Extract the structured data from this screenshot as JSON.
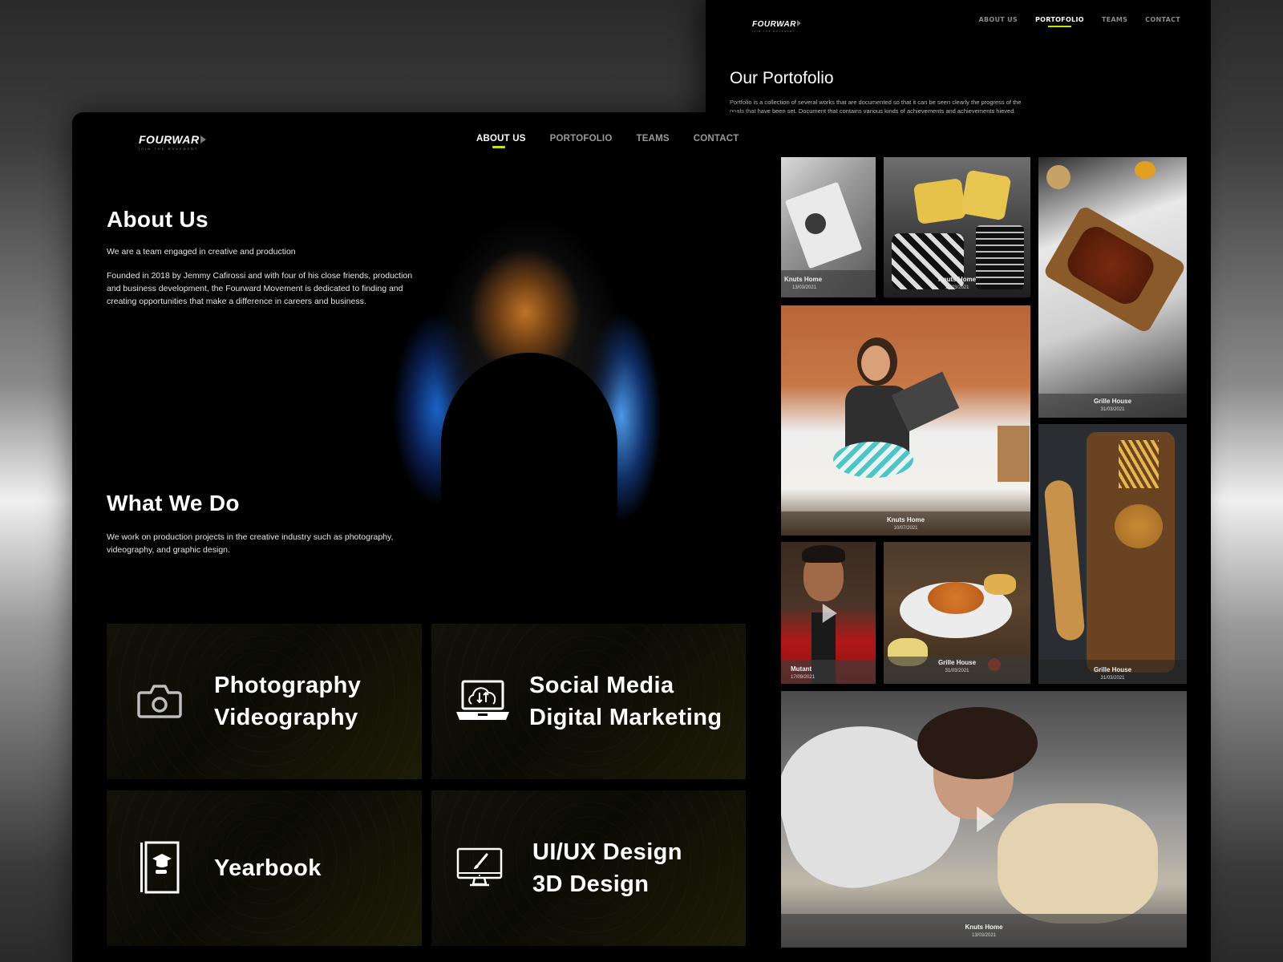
{
  "brand": {
    "name": "FOURWAR",
    "tagline": "JOIN THE MOVEMENT",
    "accent_color": "#c8e000"
  },
  "nav": {
    "items": [
      {
        "label": "ABOUT US"
      },
      {
        "label": "PORTOFOLIO"
      },
      {
        "label": "TEAMS"
      },
      {
        "label": "CONTACT"
      }
    ]
  },
  "portfolio_page": {
    "active_nav": "PORTOFOLIO",
    "title": "Our Portofolio",
    "description": "Portfolio is a collection of several works that are documented so that it can be seen clearly the progress of the goals that have been set. Document that contains various kinds of achievements and achievements hieved.",
    "items": [
      {
        "title": "Knuts Home",
        "date": "13/03/2021",
        "type": "photo"
      },
      {
        "title": "Knuts Home",
        "date": "13/03/2021",
        "type": "photo"
      },
      {
        "title": "Grille House",
        "date": "31/03/2021",
        "type": "photo"
      },
      {
        "title": "Knuts Home",
        "date": "10/07/2021",
        "type": "photo"
      },
      {
        "title": "Grille House",
        "date": "31/03/2021",
        "type": "photo"
      },
      {
        "title": "Mutant",
        "date": "17/09/2021",
        "type": "video"
      },
      {
        "title": "Grille House",
        "date": "31/03/2021",
        "type": "photo"
      },
      {
        "title": "Knuts Home",
        "date": "13/03/2021",
        "type": "video"
      }
    ]
  },
  "about_page": {
    "active_nav": "ABOUT US",
    "about_title": "About Us",
    "about_subtitle": "We are a team engaged in creative and production",
    "about_body": "Founded in 2018 by Jemmy Cafirossi and with four of his close friends, production and business development, the Fourward Movement is dedicated to finding and creating opportunities that make a difference in careers and business.",
    "what_title": "What We Do",
    "what_body": "We work on production projects in the creative industry such as photography, videography, and graphic design.",
    "services": [
      {
        "icon": "camera-icon",
        "lines": [
          "Photography",
          "Videography"
        ]
      },
      {
        "icon": "laptop-cloud-icon",
        "lines": [
          "Social Media",
          "Digital Marketing"
        ]
      },
      {
        "icon": "yearbook-icon",
        "lines": [
          "Yearbook"
        ]
      },
      {
        "icon": "monitor-brush-icon",
        "lines": [
          "UI/UX Design",
          "3D Design"
        ]
      }
    ]
  }
}
